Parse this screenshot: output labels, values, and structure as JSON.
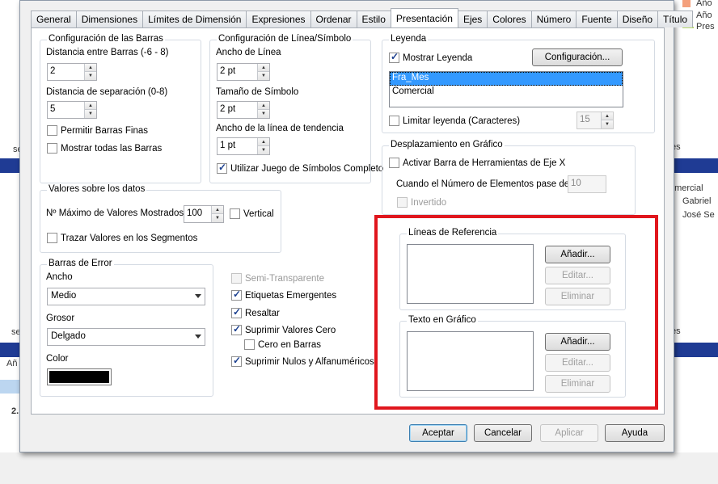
{
  "background": {
    "legend_items": [
      "Año",
      "Año",
      "Pres"
    ],
    "legend_colors": [
      "#f4a07c",
      "#f08060",
      "#b7d96c"
    ],
    "right_texts": [
      "es",
      "omercial",
      "Gabriel",
      "José Se",
      "es"
    ],
    "left_texts": [
      "se",
      "se",
      "Añ",
      "2.",
      "2."
    ]
  },
  "tabs": [
    {
      "label": "General"
    },
    {
      "label": "Dimensiones"
    },
    {
      "label": "Límites de Dimensión"
    },
    {
      "label": "Expresiones"
    },
    {
      "label": "Ordenar"
    },
    {
      "label": "Estilo"
    },
    {
      "label": "Presentación"
    },
    {
      "label": "Ejes"
    },
    {
      "label": "Colores"
    },
    {
      "label": "Número"
    },
    {
      "label": "Fuente"
    },
    {
      "label": "Diseño"
    },
    {
      "label": "Título"
    }
  ],
  "active_tab": "Presentación",
  "bars_config": {
    "title": "Configuración de las Barras",
    "gap_label": "Distancia entre Barras (-6 - 8)",
    "gap_value": "2",
    "cluster_label": "Distancia de separación (0-8)",
    "cluster_value": "5",
    "thin_label": "Permitir Barras Finas",
    "thin_checked": false,
    "all_label": "Mostrar todas las Barras",
    "all_checked": false
  },
  "line_config": {
    "title": "Configuración de Línea/Símbolo",
    "width_label": "Ancho de Línea",
    "width_value": "2 pt",
    "symbol_label": "Tamaño de Símbolo",
    "symbol_value": "2 pt",
    "trend_label": "Ancho de la línea de tendencia",
    "trend_value": "1 pt",
    "full_symbols_label": "Utilizar Juego de Símbolos Completo",
    "full_symbols_checked": true
  },
  "values_on_data": {
    "title": "Valores sobre los datos",
    "max_label": "Nº Máximo de Valores Mostrados",
    "max_value": "100",
    "vertical_label": "Vertical",
    "vertical_checked": false,
    "segments_label": "Trazar Valores en los Segmentos",
    "segments_checked": false
  },
  "error_bars": {
    "title": "Barras de Error",
    "width_label": "Ancho",
    "width_value": "Medio",
    "thickness_label": "Grosor",
    "thickness_value": "Delgado",
    "color_label": "Color",
    "color_value": "#000000"
  },
  "misc_checks": [
    {
      "label": "Semi-Transparente",
      "checked": false,
      "disabled": true
    },
    {
      "label": "Etiquetas Emergentes",
      "checked": true,
      "disabled": false
    },
    {
      "label": "Resaltar",
      "checked": true,
      "disabled": false
    },
    {
      "label": "Suprimir Valores Cero",
      "checked": true,
      "disabled": false
    },
    {
      "label": "Cero en Barras",
      "checked": false,
      "disabled": false
    },
    {
      "label": "Suprimir Nulos y Alfanuméricos",
      "checked": true,
      "disabled": false
    }
  ],
  "legend": {
    "title": "Leyenda",
    "show_label": "Mostrar Leyenda",
    "show_checked": true,
    "config_button": "Configuración...",
    "items": [
      "Fra_Mes",
      "Comercial"
    ],
    "selected_index": 0,
    "limit_label": "Limitar leyenda (Caracteres)",
    "limit_checked": false,
    "limit_value": "15"
  },
  "scroll": {
    "title": "Desplazamiento en Gráfico",
    "enable_label": "Activar Barra de Herramientas de Eje X",
    "enable_checked": false,
    "when_label": "Cuando el Número de Elementos pase de:",
    "when_value": "10",
    "invert_label": "Invertido",
    "invert_checked": false
  },
  "reference_lines": {
    "title": "Líneas de Referencia",
    "add": "Añadir...",
    "edit": "Editar...",
    "remove": "Eliminar"
  },
  "text_in_chart": {
    "title": "Texto en Gráfico",
    "add": "Añadir...",
    "edit": "Editar...",
    "remove": "Eliminar"
  },
  "footer": {
    "accept": "Aceptar",
    "cancel": "Cancelar",
    "apply": "Aplicar",
    "help": "Ayuda"
  },
  "highlight_color": "#e0161d"
}
